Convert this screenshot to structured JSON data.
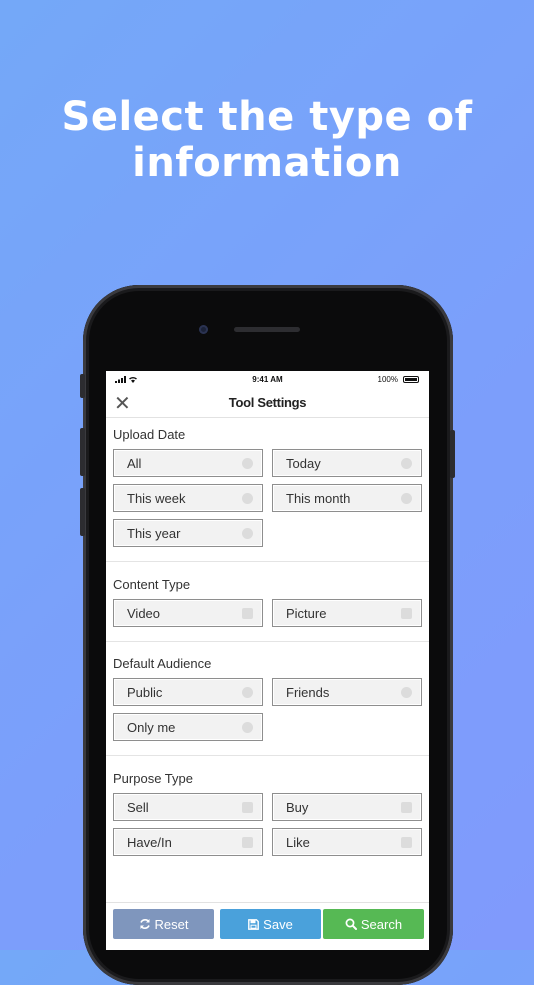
{
  "headline": {
    "line1": "Select the type of",
    "line2": "information"
  },
  "status": {
    "time": "9:41 AM",
    "battery": "100%"
  },
  "nav": {
    "title": "Tool Settings",
    "close_icon": "close-icon"
  },
  "sections": {
    "upload_date": {
      "title": "Upload Date",
      "options": [
        "All",
        "Today",
        "This week",
        "This month",
        "This year"
      ]
    },
    "content_type": {
      "title": "Content Type",
      "options": [
        "Video",
        "Picture"
      ]
    },
    "default_audience": {
      "title": "Default Audience",
      "options": [
        "Public",
        "Friends",
        "Only me"
      ]
    },
    "purpose_type": {
      "title": "Purpose Type",
      "options": [
        "Sell",
        "Buy",
        "Have/In",
        "Like"
      ]
    }
  },
  "footer": {
    "reset": {
      "label": "Reset",
      "icon": "refresh-icon",
      "color": "#7f96bd"
    },
    "save": {
      "label": "Save",
      "icon": "save-icon",
      "color": "#4aa1db"
    },
    "search": {
      "label": "Search",
      "icon": "search-icon",
      "color": "#56b954"
    }
  }
}
